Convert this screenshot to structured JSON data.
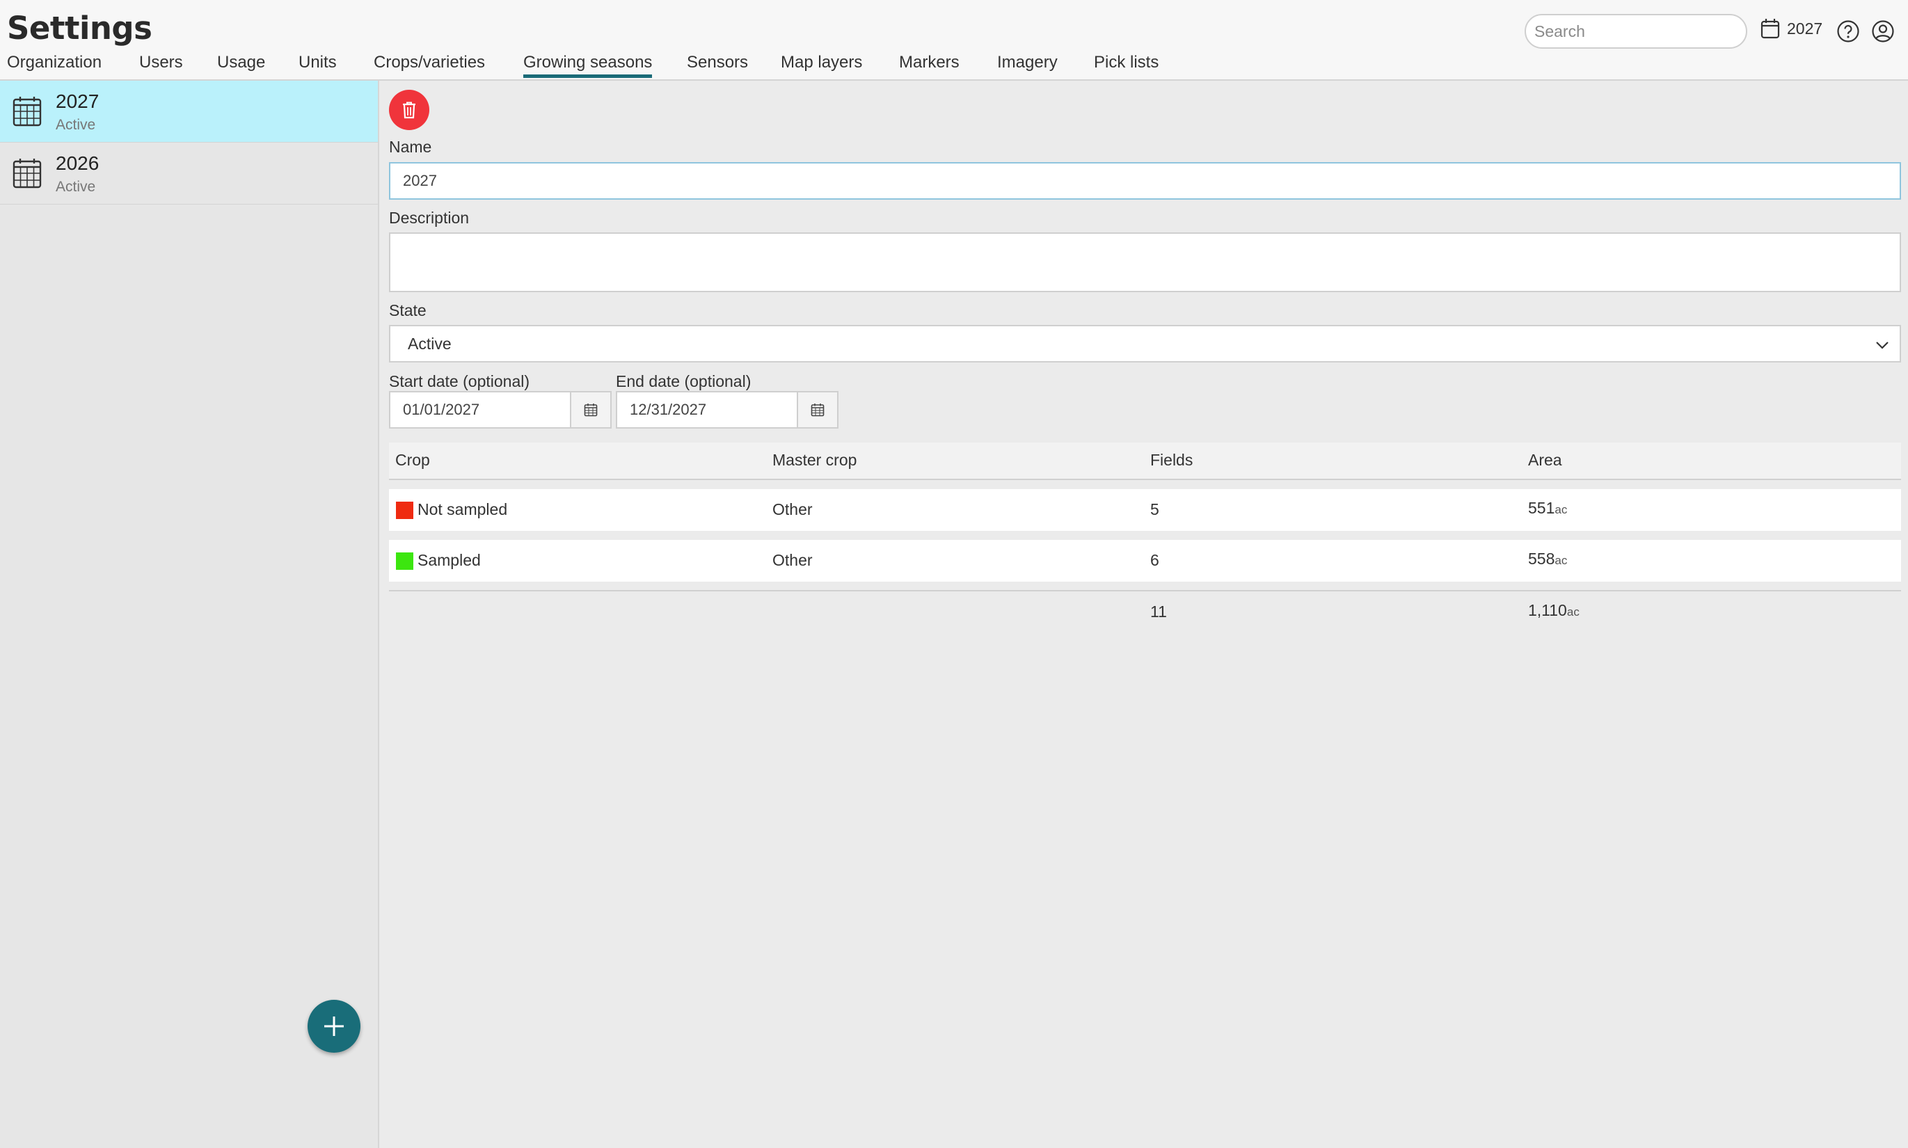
{
  "header": {
    "title": "Settings",
    "tabs": [
      {
        "label": "Organization"
      },
      {
        "label": "Users"
      },
      {
        "label": "Usage"
      },
      {
        "label": "Units"
      },
      {
        "label": "Crops/varieties"
      },
      {
        "label": "Growing seasons",
        "active": true
      },
      {
        "label": "Sensors"
      },
      {
        "label": "Map layers"
      },
      {
        "label": "Markers"
      },
      {
        "label": "Imagery"
      },
      {
        "label": "Pick lists"
      }
    ],
    "search_placeholder": "Search",
    "current_season": "2027",
    "icons": [
      "calendar-icon",
      "help-icon",
      "user-icon"
    ]
  },
  "sidebar": {
    "seasons": [
      {
        "name": "2027",
        "status": "Active",
        "selected": true
      },
      {
        "name": "2026",
        "status": "Active",
        "selected": false
      }
    ]
  },
  "form": {
    "name_label": "Name",
    "name_value": "2027",
    "description_label": "Description",
    "description_value": "",
    "state_label": "State",
    "state_value": "Active",
    "start_label": "Start date (optional)",
    "start_value": "01/01/2027",
    "end_label": "End date (optional)",
    "end_value": "12/31/2027"
  },
  "table": {
    "headers": {
      "crop": "Crop",
      "master": "Master crop",
      "fields": "Fields",
      "area": "Area"
    },
    "rows": [
      {
        "crop": "Not sampled",
        "color": "#ef2b10",
        "master": "Other",
        "fields": "5",
        "area": "551",
        "unit": "ac"
      },
      {
        "crop": "Sampled",
        "color": "#3ce60f",
        "master": "Other",
        "fields": "6",
        "area": "558",
        "unit": "ac"
      }
    ],
    "totals": {
      "fields": "11",
      "area": "1,110",
      "unit": "ac"
    }
  },
  "colors": {
    "accent": "#1a6b78",
    "selected": "#baf1fb",
    "danger": "#f0343b"
  }
}
